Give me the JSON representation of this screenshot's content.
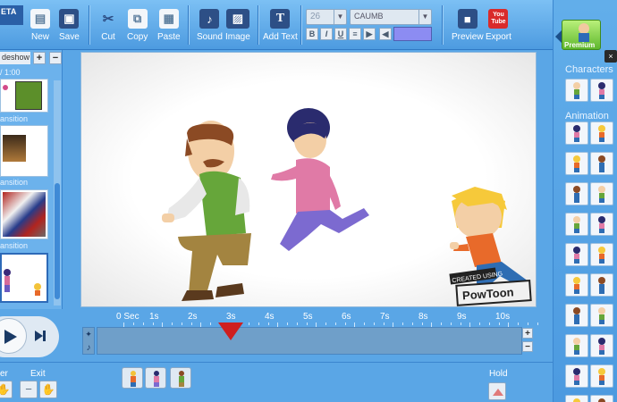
{
  "toolbar": {
    "items": [
      {
        "label": "New",
        "icon": "new-file-icon"
      },
      {
        "label": "Save",
        "icon": "save-disk-icon"
      },
      {
        "label": "Cut",
        "icon": "scissors-icon"
      },
      {
        "label": "Copy",
        "icon": "copy-icon"
      },
      {
        "label": "Paste",
        "icon": "paste-icon"
      },
      {
        "label": "Sound",
        "icon": "music-note-icon"
      },
      {
        "label": "Image",
        "icon": "image-icon"
      },
      {
        "label": "Add Text",
        "icon": "text-t-icon"
      },
      {
        "label": "Preview",
        "icon": "film-camera-icon"
      },
      {
        "label": "Export",
        "icon": "youtube-icon"
      }
    ],
    "font_size": "26",
    "font_name": "CAUMB",
    "format_buttons": [
      "B",
      "I",
      "U"
    ],
    "text_color": "#8c8cf2",
    "beta_badge": "ETA",
    "youtube_icon_text": [
      "You",
      "Tube"
    ]
  },
  "right_panel": {
    "premium_label": "Premium",
    "close_label": "×",
    "characters_title": "Characters",
    "animation_title": "Animation"
  },
  "left_panel": {
    "tab_label": "deshow",
    "add_label": "+",
    "remove_label": "−",
    "time": "/ 1:00",
    "transition_label": "ansition",
    "slides": [
      "slide-1",
      "slide-2",
      "slide-3",
      "slide-4"
    ]
  },
  "canvas": {
    "watermark_top": "CREATED USING",
    "watermark_brand": "PowToon"
  },
  "timeline": {
    "ruler": [
      "0 Sec",
      "1s",
      "2s",
      "3s",
      "4s",
      "5s",
      "6s",
      "7s",
      "8s",
      "9s",
      "10s"
    ],
    "plus": "+",
    "minus": "−",
    "enter_label": "er",
    "exit_label": "Exit",
    "hold_label": "Hold",
    "minus_btn": "−"
  },
  "colors": {
    "accent": "#5aa6e6",
    "marker": "#cf1f1f",
    "premium": "#5fb82e"
  }
}
